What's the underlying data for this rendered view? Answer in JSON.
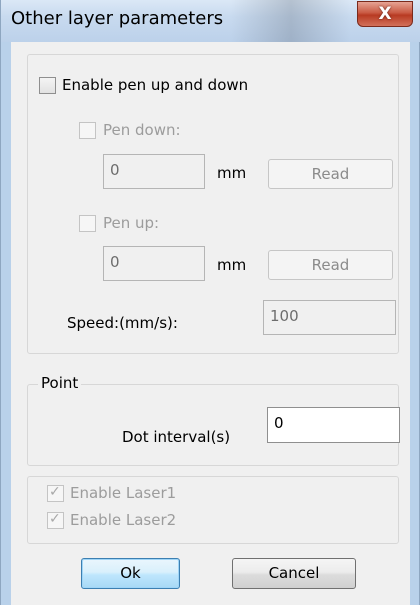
{
  "window": {
    "title": "Other layer parameters",
    "close_label": "X"
  },
  "pen": {
    "enable_label": "Enable pen up and down",
    "pen_down_label": "Pen down:",
    "pen_down_value": "0",
    "pen_up_label": "Pen up:",
    "pen_up_value": "0",
    "unit": "mm",
    "read_label": "Read",
    "speed_label": "Speed:(mm/s):",
    "speed_value": "100"
  },
  "point": {
    "group_label": "Point",
    "dot_interval_label": "Dot interval(s)",
    "dot_interval_value": "0"
  },
  "lasers": {
    "laser1_label": "Enable Laser1",
    "laser2_label": "Enable Laser2"
  },
  "buttons": {
    "ok_label": "Ok",
    "cancel_label": "Cancel"
  }
}
